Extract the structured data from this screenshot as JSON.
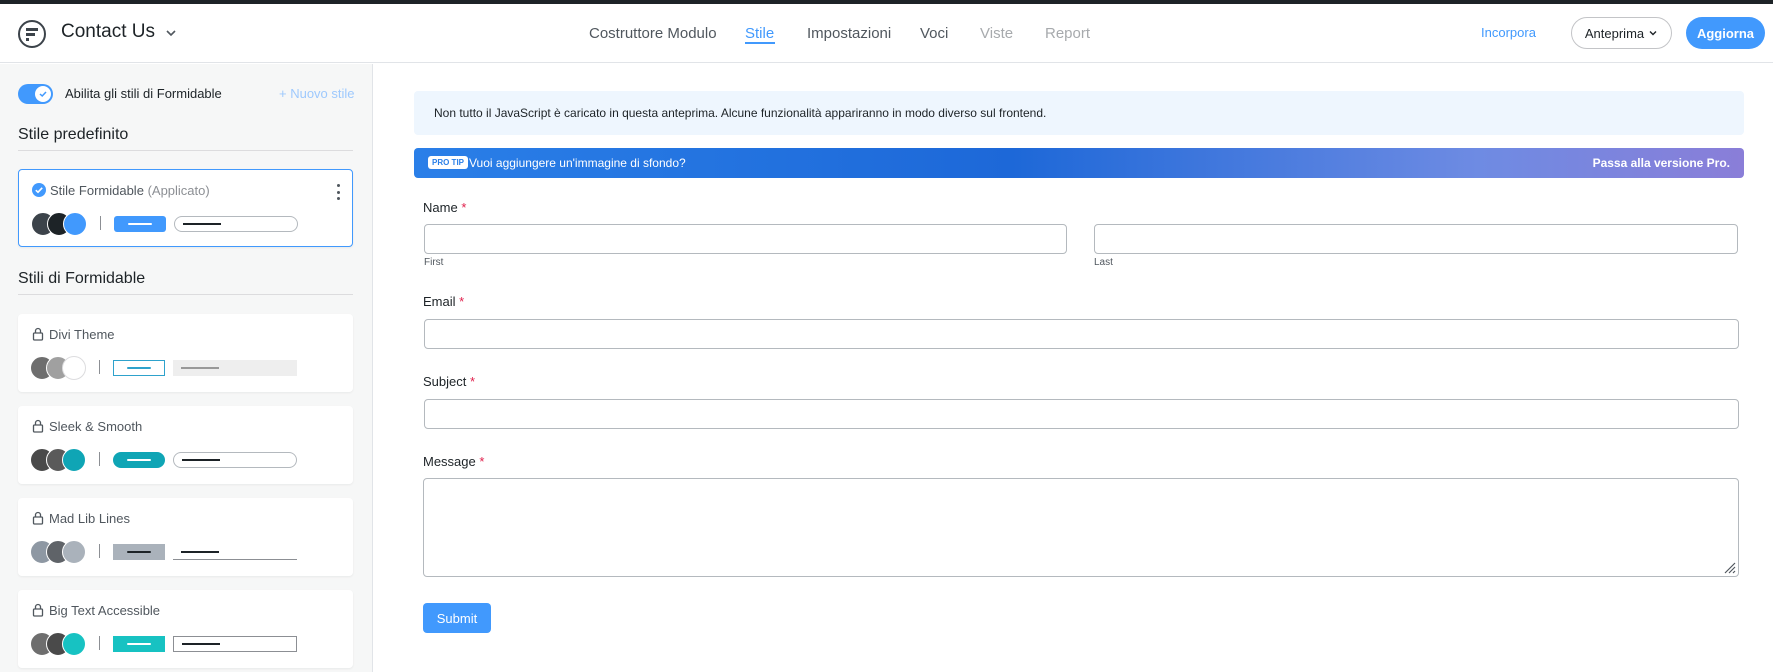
{
  "header": {
    "form_title": "Contact Us",
    "nav": [
      {
        "label": "Costruttore Modulo",
        "state": "normal"
      },
      {
        "label": "Stile",
        "state": "active"
      },
      {
        "label": "Impostazioni",
        "state": "normal"
      },
      {
        "label": "Voci",
        "state": "normal"
      },
      {
        "label": "Viste",
        "state": "disabled"
      },
      {
        "label": "Report",
        "state": "disabled"
      }
    ],
    "embed_label": "Incorpora",
    "preview_label": "Anteprima",
    "update_label": "Aggiorna"
  },
  "sidebar": {
    "toggle_label": "Abilita gli stili di Formidable",
    "toggle_on": true,
    "new_style_label": "+ Nuovo stile",
    "default_heading": "Stile predefinito",
    "default_card": {
      "name": "Stile Formidable",
      "status": "(Applicato)",
      "swatches": [
        "#3c434a",
        "#1d2327",
        "#4199fd"
      ],
      "button_color": "#4199fd"
    },
    "styles_heading": "Stili di Formidable",
    "styles": [
      {
        "name": "Divi Theme",
        "swatches": [
          "#6e6e6e",
          "#a0a0a0",
          "#ffffff"
        ]
      },
      {
        "name": "Sleek & Smooth",
        "swatches": [
          "#4a4a4a",
          "#5a5a5a",
          "#0fa5b5"
        ]
      },
      {
        "name": "Mad Lib Lines",
        "swatches": [
          "#8e98a3",
          "#5f6368",
          "#aab2bb"
        ]
      },
      {
        "name": "Big Text Accessible",
        "swatches": [
          "#6e6e6e",
          "#4a4a4a",
          "#17c2c2"
        ]
      }
    ]
  },
  "main": {
    "notice": "Non tutto il JavaScript è caricato in questa anteprima. Alcune funzionalità appariranno in modo diverso sul frontend.",
    "protip_badge": "PRO TIP",
    "protip_text": "Vuoi aggiungere un'immagine di sfondo?",
    "protip_cta": "Passa alla versione Pro.",
    "fields": {
      "name_label": "Name",
      "first_sublabel": "First",
      "last_sublabel": "Last",
      "email_label": "Email",
      "subject_label": "Subject",
      "message_label": "Message",
      "required_marker": "*"
    },
    "submit_label": "Submit"
  }
}
